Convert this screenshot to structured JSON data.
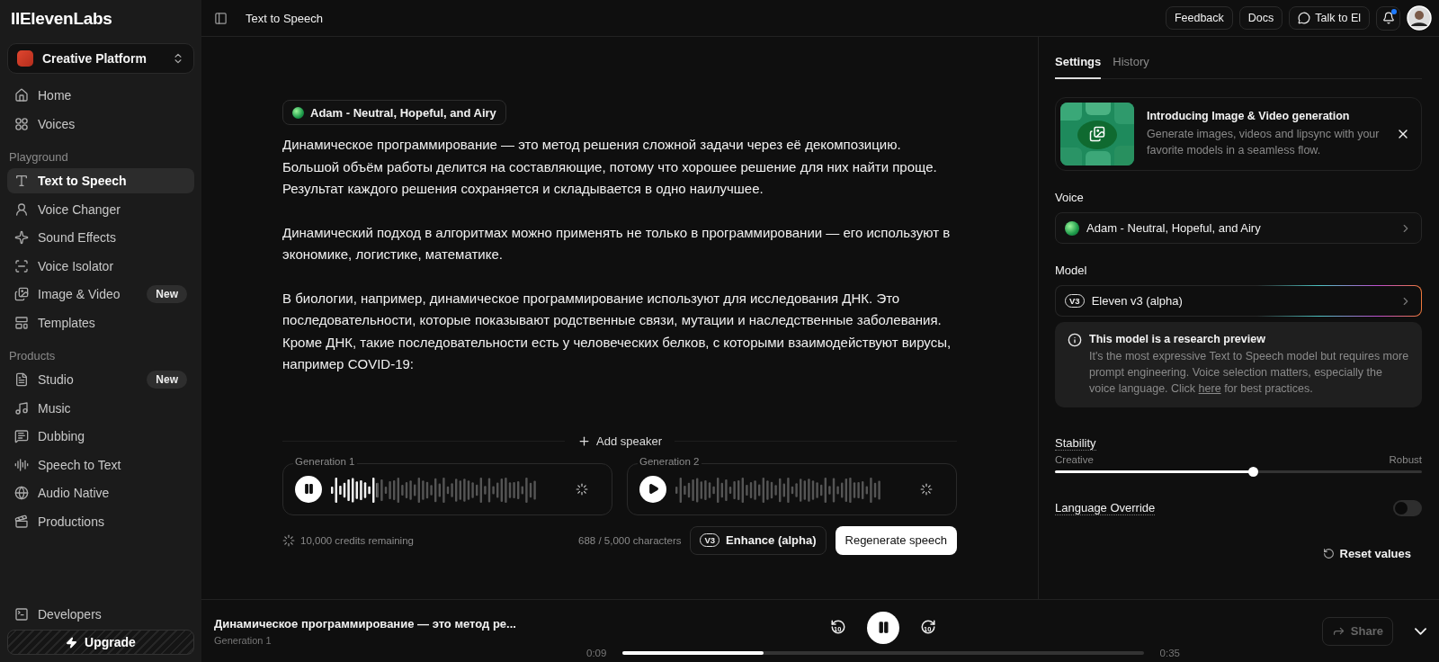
{
  "brand": "IIElevenLabs",
  "workspace": "Creative Platform",
  "sidebar": {
    "items": [
      {
        "label": "Home",
        "selected": false
      },
      {
        "label": "Voices",
        "selected": false
      }
    ],
    "sections": [
      {
        "title": "Playground",
        "items": [
          {
            "label": "Text to Speech",
            "selected": true
          },
          {
            "label": "Voice Changer",
            "selected": false
          },
          {
            "label": "Sound Effects",
            "selected": false
          },
          {
            "label": "Voice Isolator",
            "selected": false
          },
          {
            "label": "Image & Video",
            "selected": false,
            "badge": "New"
          },
          {
            "label": "Templates",
            "selected": false
          }
        ]
      },
      {
        "title": "Products",
        "items": [
          {
            "label": "Studio",
            "selected": false,
            "badge": "New"
          },
          {
            "label": "Music",
            "selected": false
          },
          {
            "label": "Dubbing",
            "selected": false
          },
          {
            "label": "Speech to Text",
            "selected": false
          },
          {
            "label": "Audio Native",
            "selected": false
          },
          {
            "label": "Productions",
            "selected": false
          }
        ]
      }
    ],
    "footer_items": [
      {
        "label": "Developers",
        "selected": false
      }
    ],
    "upgrade": "Upgrade"
  },
  "header": {
    "title": "Text to Speech",
    "buttons": [
      "Feedback",
      "Docs",
      "Talk to El"
    ],
    "unread": true
  },
  "editor": {
    "voice": "Adam - Neutral, Hopeful, and Airy",
    "paragraphs": [
      "Динамическое программирование — это метод решения сложной задачи через её декомпозицию. Большой объём работы делится на составляющие, потому что хорошее решение для них найти проще. Результат каждого решения сохраняется и складывается в одно наилучшее.",
      "Динамический подход в алгоритмах можно применять не только в программировании — его используют в экономике, логистике, математике.",
      "В биологии, например, динамическое программирование используют для исследования ДНК. Это последовательности, которые показывают родственные связи, мутации и наследственные заболевания. Кроме ДНК, такие последовательности есть у человеческих белков, с которыми взаимодействуют вирусы, например COVID-19:"
    ],
    "add_speaker": "Add speaker",
    "generations": [
      {
        "label": "Generation 1",
        "playing": true,
        "level": 0.22
      },
      {
        "label": "Generation 2",
        "playing": false
      }
    ],
    "credits": "10,000 credits remaining",
    "char_count": "688 / 5,000 characters",
    "enhance": {
      "badge": "V3",
      "label": "Enhance (alpha)"
    },
    "regenerate": "Regenerate speech"
  },
  "settings": {
    "tabs": [
      {
        "label": "Settings",
        "selected": true
      },
      {
        "label": "History",
        "selected": false
      }
    ],
    "promo": {
      "title": "Introducing Image & Video generation",
      "text": "Generate images, videos and lipsync with your favorite models in a seamless flow."
    },
    "voice": {
      "label": "Voice",
      "value": "Adam - Neutral, Hopeful, and Airy"
    },
    "model": {
      "label": "Model",
      "badge": "V3",
      "value": "Eleven v3 (alpha)"
    },
    "notice": {
      "title": "This model is a research preview",
      "text_before": "It's the most expressive Text to Speech model but requires more prompt engineering. Voice selection matters, especially the voice language. Click",
      "link": "here",
      "text_after": "for best practices."
    },
    "stability": {
      "label": "Stability",
      "min_label": "Creative",
      "max_label": "Robust",
      "level": 0.54
    },
    "language_override": {
      "label": "Language Override",
      "on": false
    },
    "reset": "Reset values"
  },
  "player": {
    "title": "Динамическое программирование — это метод ре...",
    "subtitle": "Generation 1",
    "playing": true,
    "skip_back": "10",
    "skip_forward": "10",
    "elapsed": "0:09",
    "total": "0:35",
    "level": 0.27,
    "share": {
      "label": "Share",
      "disabled": true
    }
  }
}
